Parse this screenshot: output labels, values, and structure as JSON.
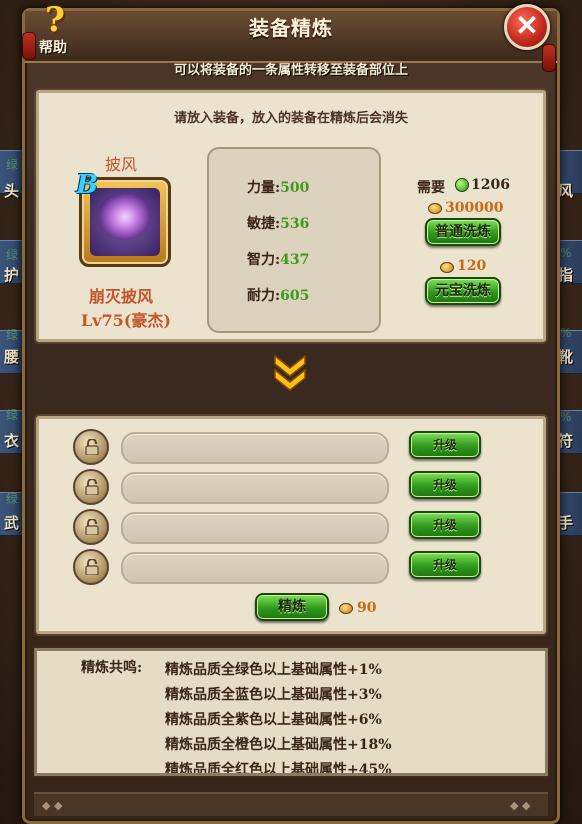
{
  "window": {
    "title": "装备精炼",
    "subtitle": "可以将装备的一条属性转移至装备部位上"
  },
  "help": {
    "glyph": "?",
    "label": "帮助"
  },
  "close": {
    "glyph": "✕"
  },
  "background": {
    "left": [
      "头",
      "护",
      "腰",
      "衣",
      "武"
    ],
    "right": [
      "风",
      "指",
      "靴",
      "符",
      "手"
    ],
    "grade_left": "绿",
    "grade_right": "%"
  },
  "top": {
    "hint": "请放入装备，放入的装备在精炼后会消失",
    "item": {
      "short_name": "披风",
      "grade": "B",
      "full_name": "崩灭披风",
      "level": "Lv75(豪杰)"
    },
    "stats": [
      {
        "label": "力量:",
        "value": "500"
      },
      {
        "label": "敏捷:",
        "value": "536"
      },
      {
        "label": "智力:",
        "value": "437"
      },
      {
        "label": "耐力:",
        "value": "605"
      }
    ],
    "requirement": {
      "label": "需要",
      "gem_amount": "1206",
      "coin_amount": "300000",
      "ingot_amount": "120"
    },
    "buttons": {
      "normal_wash": "普通洗炼",
      "ingot_wash": "元宝洗炼"
    }
  },
  "slots": {
    "upgrade_label": "升级",
    "refine_label": "精炼",
    "refine_cost": "90"
  },
  "resonance": {
    "label": "精炼共鸣:",
    "lines": [
      "精炼品质全绿色以上基础属性+1%",
      "精炼品质全蓝色以上基础属性+3%",
      "精炼品质全紫色以上基础属性+6%",
      "精炼品质全橙色以上基础属性+18%",
      "精炼品质全红色以上基础属性+45%"
    ]
  },
  "colors": {
    "stat_value": "#3c9a1c",
    "item_name": "#c1552b",
    "button": "#2f9a1c"
  }
}
